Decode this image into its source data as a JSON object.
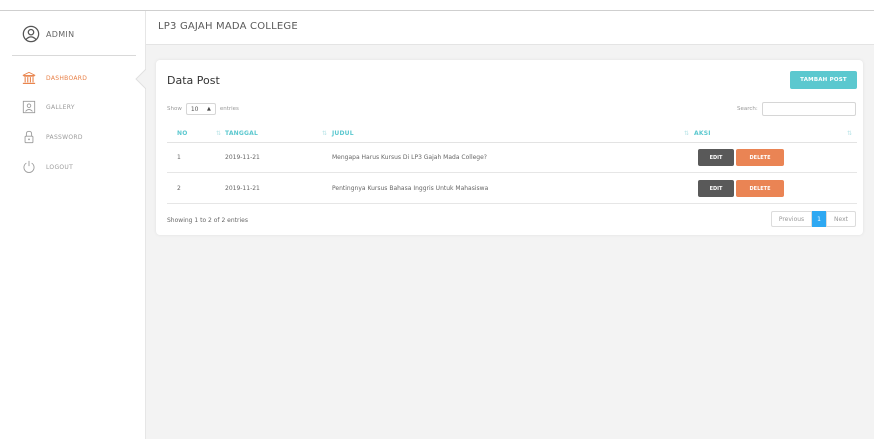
{
  "app": {
    "brand_label": "ADMIN",
    "header_title": "LP3 GAJAH MADA COLLEGE"
  },
  "sidebar": {
    "items": [
      {
        "label": "DASHBOARD",
        "icon": "building-icon",
        "active": true
      },
      {
        "label": "GALLERY",
        "icon": "image-icon",
        "active": false
      },
      {
        "label": "PASSWORD",
        "icon": "lock-icon",
        "active": false
      },
      {
        "label": "LOGOUT",
        "icon": "power-icon",
        "active": false
      }
    ]
  },
  "card": {
    "title": "Data Post",
    "add_button": "TAMBAH POST",
    "length": {
      "prefix": "Show",
      "value": "10",
      "suffix": "entries"
    },
    "search_label": "Search:",
    "search_value": "",
    "columns": [
      "NO",
      "TANGGAL",
      "JUDUL",
      "AKSI"
    ],
    "rows": [
      {
        "no": "1",
        "tanggal": "2019-11-21",
        "judul": "Mengapa Harus Kursus Di LP3 Gajah Mada College?",
        "edit": "EDIT",
        "delete": "DELETE"
      },
      {
        "no": "2",
        "tanggal": "2019-11-21",
        "judul": "Pentingnya Kursus Bahasa Inggris Untuk Mahasiswa",
        "edit": "EDIT",
        "delete": "DELETE"
      }
    ],
    "info": "Showing 1 to 2 of 2 entries",
    "pagination": {
      "previous": "Previous",
      "current": "1",
      "next": "Next"
    }
  },
  "colors": {
    "accent": "#5bc8cf",
    "active": "#e87f45",
    "delete": "#ea8454",
    "edit": "#595959",
    "page_current": "#2ea8f2"
  }
}
